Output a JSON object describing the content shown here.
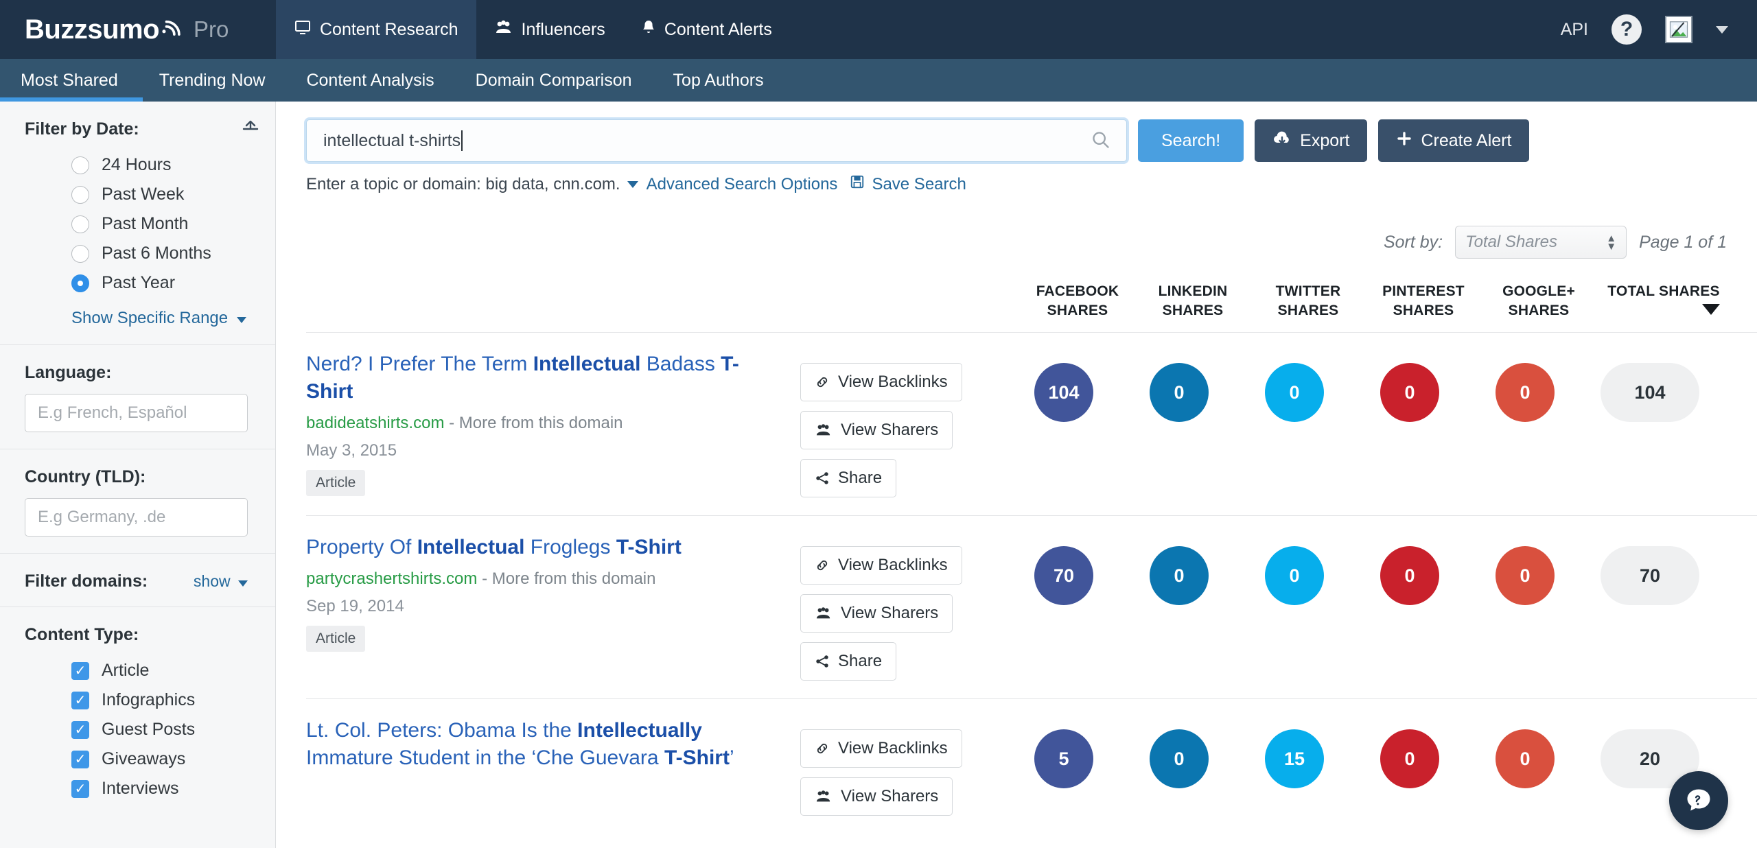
{
  "topnav": {
    "brand_name": "Buzzsumo",
    "brand_tier": "Pro",
    "items": [
      {
        "label": "Content Research",
        "icon": "monitor-icon",
        "active": true
      },
      {
        "label": "Influencers",
        "icon": "people-icon",
        "active": false
      },
      {
        "label": "Content Alerts",
        "icon": "bell-icon",
        "active": false
      }
    ],
    "api_label": "API",
    "help_label": "?"
  },
  "subnav": {
    "items": [
      {
        "label": "Most Shared",
        "active": true
      },
      {
        "label": "Trending Now",
        "active": false
      },
      {
        "label": "Content Analysis",
        "active": false
      },
      {
        "label": "Domain Comparison",
        "active": false
      },
      {
        "label": "Top Authors",
        "active": false
      }
    ]
  },
  "sidebar": {
    "date": {
      "title": "Filter by Date:",
      "options": [
        {
          "label": "24 Hours",
          "selected": false
        },
        {
          "label": "Past Week",
          "selected": false
        },
        {
          "label": "Past Month",
          "selected": false
        },
        {
          "label": "Past 6 Months",
          "selected": false
        },
        {
          "label": "Past Year",
          "selected": true
        }
      ],
      "range_link": "Show Specific Range"
    },
    "language": {
      "title": "Language:",
      "placeholder": "E.g French, Español",
      "value": ""
    },
    "country": {
      "title": "Country (TLD):",
      "placeholder": "E.g Germany, .de",
      "value": ""
    },
    "domains": {
      "title": "Filter domains:",
      "show_label": "show"
    },
    "content_type": {
      "title": "Content Type:",
      "options": [
        {
          "label": "Article",
          "checked": true
        },
        {
          "label": "Infographics",
          "checked": true
        },
        {
          "label": "Guest Posts",
          "checked": true
        },
        {
          "label": "Giveaways",
          "checked": true
        },
        {
          "label": "Interviews",
          "checked": true
        }
      ]
    }
  },
  "search": {
    "value": "intellectual t-shirts",
    "placeholder": "Enter a topic or domain",
    "search_button": "Search!",
    "export_button": "Export",
    "create_alert_button": "Create Alert",
    "hint_text": "Enter a topic or domain: big data, cnn.com.",
    "advanced_link": "Advanced Search Options",
    "save_link": "Save Search"
  },
  "toolbar": {
    "sort_by_label": "Sort by:",
    "sort_value": "Total Shares",
    "page_label": "Page 1 of 1"
  },
  "columns": [
    {
      "line1": "FACEBOOK",
      "line2": "SHARES",
      "key": "facebook",
      "color": "#41559A"
    },
    {
      "line1": "LINKEDIN",
      "line2": "SHARES",
      "key": "linkedin",
      "color": "#0B76B0"
    },
    {
      "line1": "TWITTER",
      "line2": "SHARES",
      "key": "twitter",
      "color": "#07AEEC"
    },
    {
      "line1": "PINTEREST",
      "line2": "SHARES",
      "key": "pinterest",
      "color": "#C9212C"
    },
    {
      "line1": "GOOGLE+",
      "line2": "SHARES",
      "key": "googleplus",
      "color": "#D9503E"
    },
    {
      "line1": "TOTAL SHARES",
      "line2": "",
      "key": "total",
      "color": "#EFF0F1"
    }
  ],
  "actions": {
    "backlinks": "View Backlinks",
    "sharers": "View Sharers",
    "share": "Share"
  },
  "more_from_domain": "- More from this domain",
  "results": [
    {
      "title_parts": [
        {
          "text": "Nerd? I Prefer The Term ",
          "bold": false
        },
        {
          "text": "Intellectual",
          "bold": true
        },
        {
          "text": " Badass ",
          "bold": false
        },
        {
          "text": "T-Shirt",
          "bold": true
        }
      ],
      "domain": "badideatshirts.com",
      "date": "May 3, 2015",
      "tag": "Article",
      "facebook": "104",
      "linkedin": "0",
      "twitter": "0",
      "pinterest": "0",
      "googleplus": "0",
      "total": "104"
    },
    {
      "title_parts": [
        {
          "text": "Property Of ",
          "bold": false
        },
        {
          "text": "Intellectual",
          "bold": true
        },
        {
          "text": " Froglegs ",
          "bold": false
        },
        {
          "text": "T-Shirt",
          "bold": true
        }
      ],
      "domain": "partycrashertshirts.com",
      "date": "Sep 19, 2014",
      "tag": "Article",
      "facebook": "70",
      "linkedin": "0",
      "twitter": "0",
      "pinterest": "0",
      "googleplus": "0",
      "total": "70"
    },
    {
      "title_parts": [
        {
          "text": "Lt. Col. Peters: Obama Is the ",
          "bold": false
        },
        {
          "text": "Intellectually",
          "bold": true
        },
        {
          "text": " Immature Student in the ‘Che Guevara ",
          "bold": false
        },
        {
          "text": "T-Shirt",
          "bold": true
        },
        {
          "text": "’",
          "bold": false
        }
      ],
      "domain": "",
      "date": "",
      "tag": "",
      "facebook": "5",
      "linkedin": "0",
      "twitter": "15",
      "pinterest": "0",
      "googleplus": "0",
      "total": "20"
    }
  ]
}
